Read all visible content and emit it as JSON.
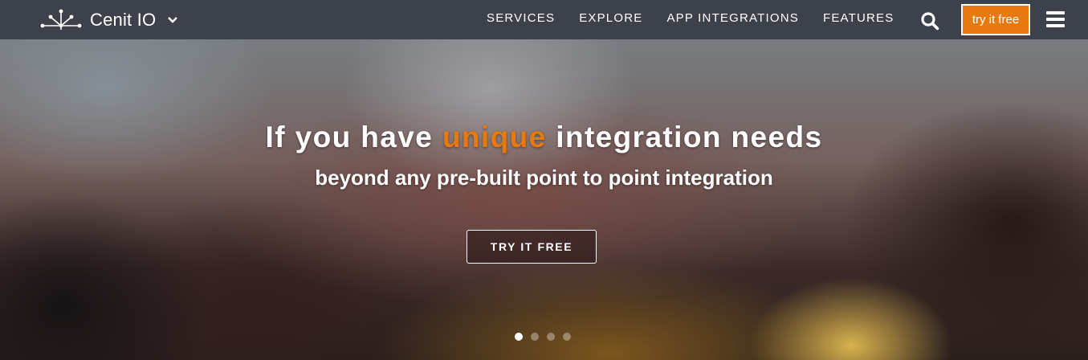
{
  "navbar": {
    "brand": {
      "name": "Cenit IO",
      "logo_icon": "network-hub-icon",
      "dropdown_icon": "chevron-down-icon"
    },
    "links": [
      {
        "label": "SERVICES"
      },
      {
        "label": "EXPLORE"
      },
      {
        "label": "APP INTEGRATIONS"
      },
      {
        "label": "FEATURES"
      }
    ],
    "search_icon": "search-icon",
    "try_button_label": "try it free",
    "menu_icon": "hamburger-menu-icon"
  },
  "hero": {
    "headline_before": "If you have ",
    "headline_accent": "unique",
    "headline_after": " integration needs",
    "subheadline": "beyond any pre-built point to point integration",
    "cta_label": "TRY IT FREE",
    "slides": {
      "count": 4,
      "active_index": 0
    }
  },
  "colors": {
    "navbar_bg": "#3d424a",
    "accent": "#e67a0e",
    "text": "#ffffff"
  }
}
